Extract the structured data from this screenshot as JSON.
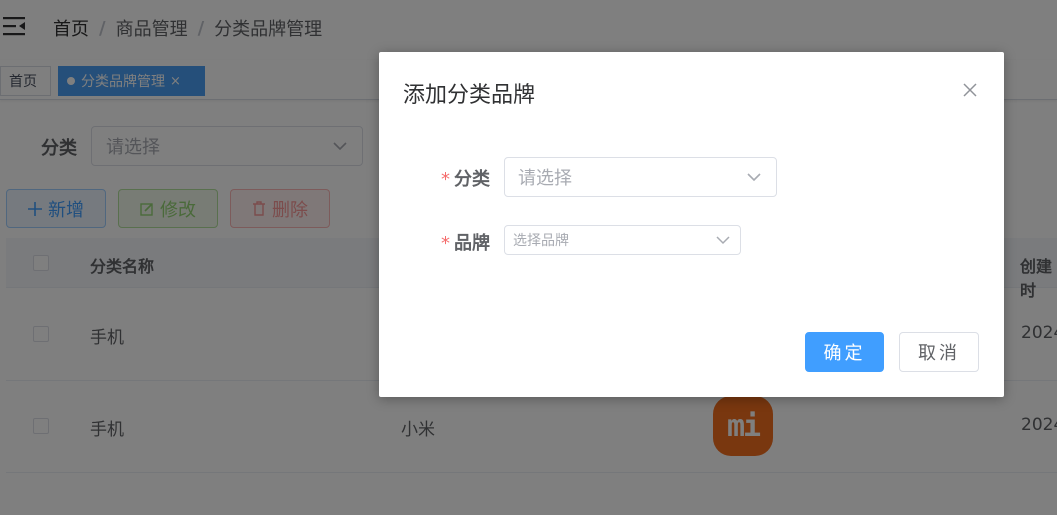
{
  "breadcrumb": {
    "items": [
      "首页",
      "商品管理",
      "分类品牌管理"
    ],
    "separator": "/"
  },
  "tags": {
    "home": "首页",
    "active": "分类品牌管理",
    "close_glyph": "×"
  },
  "filter": {
    "label": "分类",
    "placeholder": "请选择"
  },
  "toolbar": {
    "add": "新增",
    "edit": "修改",
    "delete": "删除"
  },
  "table": {
    "headers": {
      "category": "分类名称",
      "created": "创建时"
    },
    "rows": [
      {
        "category": "手机",
        "brand": "",
        "logo": "",
        "created": "2024"
      },
      {
        "category": "手机",
        "brand": "小米",
        "logo": "mi",
        "created": "2024"
      }
    ]
  },
  "dialog": {
    "title": "添加分类品牌",
    "required_mark": "*",
    "category_label": "分类",
    "category_placeholder": "请选择",
    "brand_label": "品牌",
    "brand_placeholder": "选择品牌",
    "confirm": "确定",
    "cancel": "取消"
  },
  "colors": {
    "primary": "#409eff",
    "tag_active": "#4a9ff5",
    "danger": "#f56c6c",
    "brand_logo": "#f36e1f"
  },
  "icons": [
    "menu-fold-icon",
    "tag-dot-icon",
    "tag-close-icon",
    "chevron-down-icon",
    "plus-icon",
    "edit-icon",
    "trash-icon",
    "close-icon",
    "xiaomi-logo"
  ]
}
